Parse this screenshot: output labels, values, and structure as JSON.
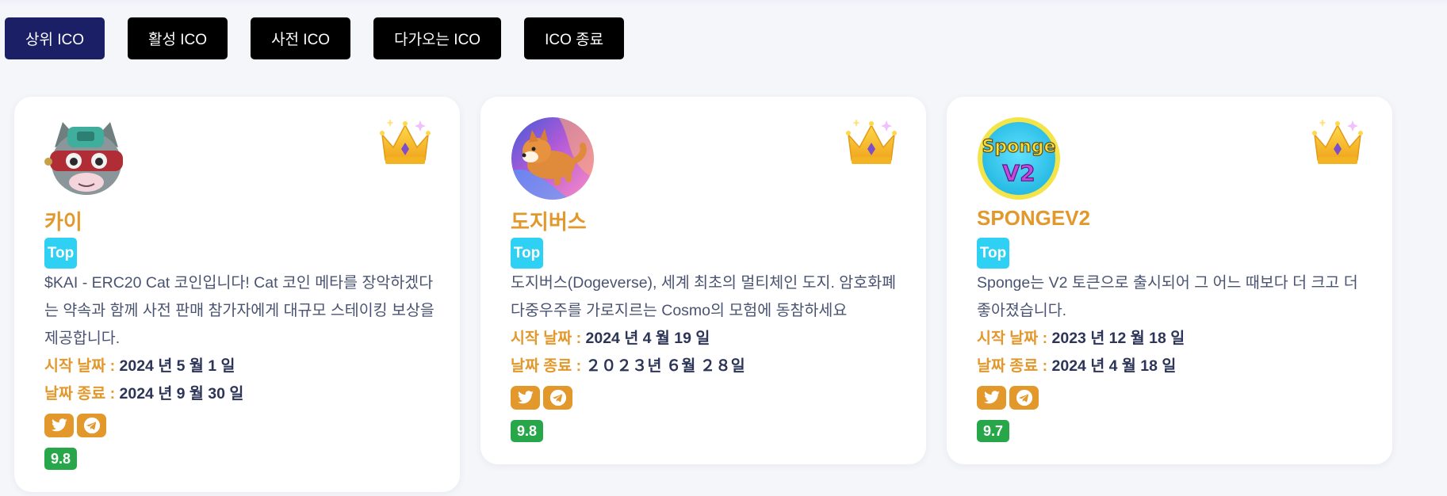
{
  "tabs": [
    {
      "label": "상위 ICO",
      "active": true
    },
    {
      "label": "활성 ICO",
      "active": false
    },
    {
      "label": "사전 ICO",
      "active": false
    },
    {
      "label": "다가오는 ICO",
      "active": false
    },
    {
      "label": "ICO 종료",
      "active": false
    }
  ],
  "colors": {
    "accent": "#e2982b",
    "active_tab": "#1b1f66",
    "tab": "#000000",
    "top_badge": "#2ed0f3",
    "score": "#27a74a",
    "value_text": "#2c3557"
  },
  "cards": [
    {
      "name": "카이",
      "badge": "Top",
      "description": "$KAI - ERC20 Cat 코인입니다! Cat 코인 메타를 장악하겠다는 약속과 함께 사전 판매 참가자에게 대규모 스테이킹 보상을 제공합니다.",
      "start_label": "시작 날짜 :",
      "start_value": "2024 년 5 월 1 일",
      "end_label": "날짜 종료 :",
      "end_value": "2024 년 9 월 30 일",
      "score": "9.8",
      "logo_icon": "cat-robot-logo-icon",
      "crown_icon": "crown-icon"
    },
    {
      "name": "도지버스",
      "badge": "Top",
      "description": "도지버스(Dogeverse), 세계 최초의 멀티체인 도지. 암호화폐 다중우주를 가로지르는 Cosmo의 모험에 동참하세요",
      "start_label": "시작 날짜 :",
      "start_value": "2024 년 4 월 19 일",
      "end_label": "날짜 종료 :",
      "end_value": "２０２３년 ６월 ２８일",
      "score": "9.8",
      "logo_icon": "shiba-dog-logo-icon",
      "crown_icon": "crown-icon"
    },
    {
      "name": "SPONGEV2",
      "badge": "Top",
      "description": "Sponge는 V2 토큰으로 출시되어 그 어느 때보다 더 크고 더 좋아졌습니다.",
      "start_label": "시작 날짜 :",
      "start_value": "2023 년 12 월 18 일",
      "end_label": "날짜 종료 :",
      "end_value": "2024 년 4 월 18 일",
      "score": "9.7",
      "logo_icon": "sponge-v2-logo-icon",
      "logo_text_top": "Sponge",
      "logo_text_bottom": "V2",
      "crown_icon": "crown-icon"
    }
  ]
}
